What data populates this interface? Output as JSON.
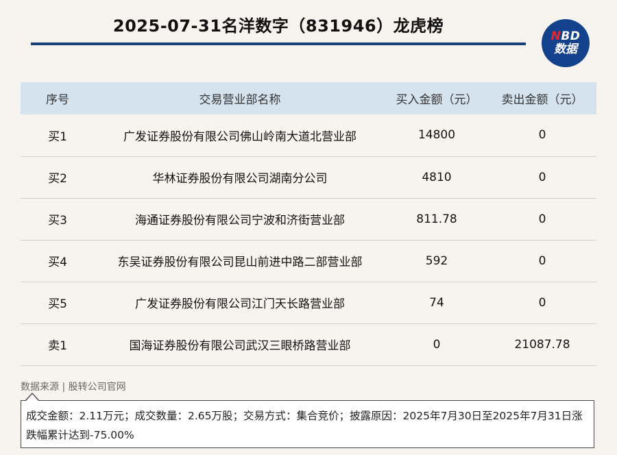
{
  "header": {
    "title": "2025-07-31名洋数字（831946）龙虎榜",
    "logo_top_n": "N",
    "logo_top_rest": "BD",
    "logo_bottom": "数据"
  },
  "table": {
    "columns": [
      "序号",
      "交易营业部名称",
      "买入金额（元）",
      "卖出金额（元）"
    ],
    "rows": [
      {
        "seq": "买1",
        "name": "广发证券股份有限公司佛山岭南大道北营业部",
        "buy": "14800",
        "sell": "0"
      },
      {
        "seq": "买2",
        "name": "华林证券股份有限公司湖南分公司",
        "buy": "4810",
        "sell": "0"
      },
      {
        "seq": "买3",
        "name": "海通证券股份有限公司宁波和济街营业部",
        "buy": "811.78",
        "sell": "0"
      },
      {
        "seq": "买4",
        "name": "东吴证券股份有限公司昆山前进中路二部营业部",
        "buy": "592",
        "sell": "0"
      },
      {
        "seq": "买5",
        "name": "广发证券股份有限公司江门天长路营业部",
        "buy": "74",
        "sell": "0"
      },
      {
        "seq": "卖1",
        "name": "国海证券股份有限公司武汉三眼桥路营业部",
        "buy": "0",
        "sell": "21087.78"
      }
    ]
  },
  "footer": {
    "source": "数据来源 | 股转公司官网",
    "note": "成交金额：2.11万元；成交数量：2.65万股；交易方式：集合竞价；披露原因：2025年7月30日至2025年7月31日涨跌幅累计达到-75.00%"
  }
}
